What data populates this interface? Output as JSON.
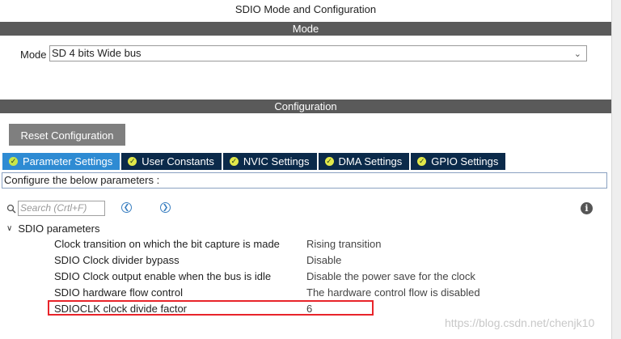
{
  "window": {
    "title": "SDIO Mode and Configuration"
  },
  "mode_section": {
    "header": "Mode",
    "mode_label": "Mode",
    "mode_value": "SD 4 bits Wide bus"
  },
  "config_section": {
    "header": "Configuration",
    "reset_button": "Reset Configuration",
    "tabs": [
      {
        "label": "Parameter Settings",
        "active": true
      },
      {
        "label": "User Constants",
        "active": false
      },
      {
        "label": "NVIC Settings",
        "active": false
      },
      {
        "label": "DMA Settings",
        "active": false
      },
      {
        "label": "GPIO Settings",
        "active": false
      }
    ],
    "description": "Configure the below parameters :",
    "search_placeholder": "Search (Crtl+F)",
    "group_label": "SDIO parameters",
    "params": [
      {
        "name": "Clock transition on which the bit capture is made",
        "value": "Rising transition"
      },
      {
        "name": "SDIO Clock divider bypass",
        "value": "Disable"
      },
      {
        "name": "SDIO Clock output enable when the bus is idle",
        "value": "Disable the power save for the clock"
      },
      {
        "name": "SDIO hardware flow control",
        "value": "The hardware control flow is disabled"
      },
      {
        "name": "SDIOCLK clock divide factor",
        "value": "6"
      }
    ]
  },
  "watermark": "https://blog.csdn.net/chenjk10",
  "colors": {
    "active_tab": "#2e8bd3",
    "tab": "#0b2a4a",
    "section_bar": "#5a5a5a",
    "highlight": "#e8242a"
  }
}
